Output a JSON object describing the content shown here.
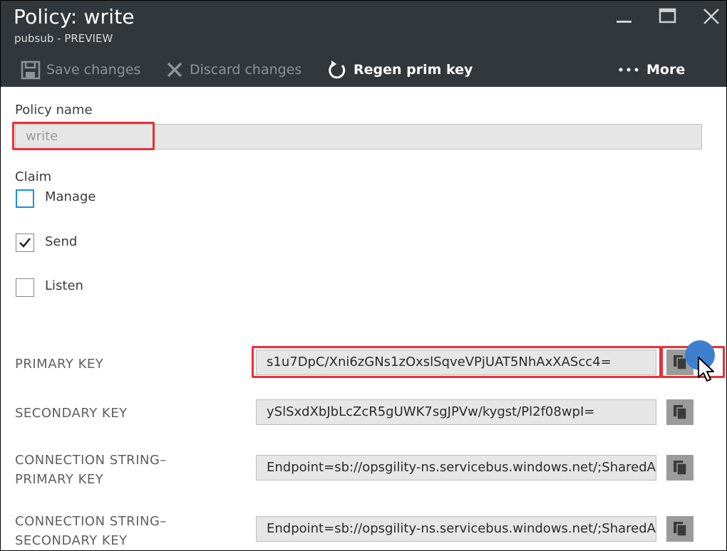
{
  "header": {
    "title": "Policy: write",
    "subtitle": "pubsub - PREVIEW"
  },
  "toolbar": {
    "save_label": "Save changes",
    "discard_label": "Discard changes",
    "regen_label": "Regen prim key",
    "more_label": "More"
  },
  "form": {
    "policy_name_label": "Policy name",
    "policy_name_value": "write",
    "claim_label": "Claim",
    "claims": [
      {
        "label": "Manage",
        "checked": false
      },
      {
        "label": "Send",
        "checked": true
      },
      {
        "label": "Listen",
        "checked": false
      }
    ]
  },
  "keys": [
    {
      "label": "PRIMARY KEY",
      "value": "s1u7DpC/Xni6zGNs1zOxslSqveVPjUAT5NhAxXAScc4="
    },
    {
      "label": "SECONDARY KEY",
      "value": "ySlSxdXbJbLcZcR5gUWK7sgJPVw/kygst/Pl2f08wpI="
    },
    {
      "label_line1": "CONNECTION STRING–",
      "label_line2": "PRIMARY KEY",
      "value": "Endpoint=sb://opsgility-ns.servicebus.windows.net/;SharedAccessKeyName=write"
    },
    {
      "label_line1": "CONNECTION STRING–",
      "label_line2": "SECONDARY KEY",
      "value": "Endpoint=sb://opsgility-ns.servicebus.windows.net/;SharedAccessKeyName=write"
    }
  ],
  "colors": {
    "header_bg": "#32373b",
    "highlight": "#e8303a",
    "checkbox_focus": "#1e90d6",
    "cursor_dot": "#3d7fcf"
  }
}
